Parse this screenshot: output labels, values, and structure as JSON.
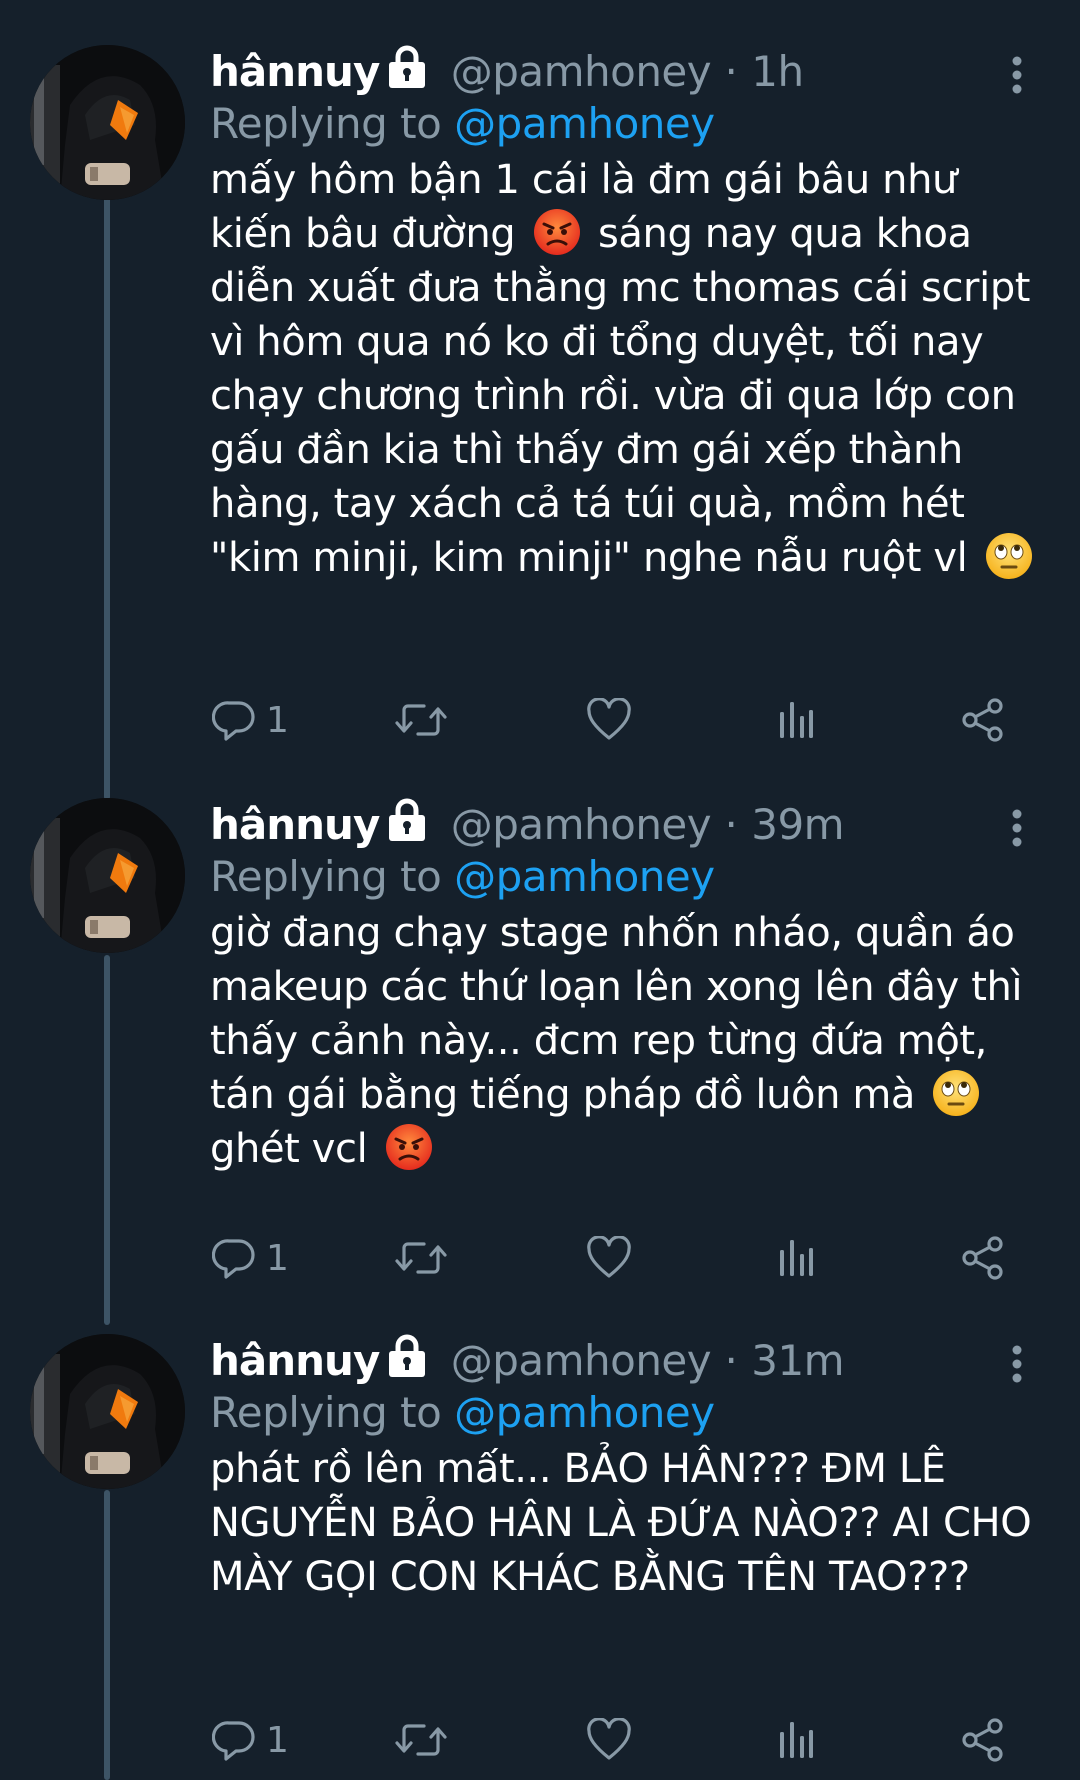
{
  "colors": {
    "background": "#15202b",
    "secondary_text": "#8899a6",
    "mention": "#1da1f2",
    "thread_line": "#3d5466"
  },
  "tweets": [
    {
      "name": "hânnuy",
      "handle": "@pamhoney",
      "dot": "·",
      "time": "1h",
      "replying_prefix": "Replying to",
      "replying_to": "@pamhoney",
      "body_parts": [
        "mấy hôm bận 1 cái là đm gái bâu như kiến bâu đường",
        "sáng nay qua khoa diễn xuất đưa thằng mc thomas cái script vì hôm qua nó ko đi tổng duyệt, tối nay chạy chương trình rồi. vừa đi qua lớp con gấu đần kia thì thấy đm gái xếp thành hàng, tay xách cả tá túi quà, mồm hét \"kim minji, kim minji\" nghe nẫu ruột vl"
      ],
      "emojis": [
        "angry-face",
        "face-with-rolling-eyes"
      ],
      "reply_count": "1"
    },
    {
      "name": "hânnuy",
      "handle": "@pamhoney",
      "dot": "·",
      "time": "39m",
      "replying_prefix": "Replying to",
      "replying_to": "@pamhoney",
      "body_parts": [
        "giờ đang chạy stage nhốn nháo, quần áo makeup các thứ loạn lên xong lên đây thì thấy cảnh này... đcm rep từng đứa một, tán gái bằng tiếng pháp đồ luôn mà",
        "ghét vcl"
      ],
      "emojis": [
        "face-with-rolling-eyes",
        "angry-face"
      ],
      "reply_count": "1"
    },
    {
      "name": "hânnuy",
      "handle": "@pamhoney",
      "dot": "·",
      "time": "31m",
      "replying_prefix": "Replying to",
      "replying_to": "@pamhoney",
      "body_parts": [
        "phát rồ lên mất... BẢO HÂN??? ĐM LÊ NGUYỄN BẢO HÂN LÀ ĐỨA NÀO?? AI CHO MÀY GỌI CON KHÁC BẰNG TÊN TAO???"
      ],
      "emojis": [],
      "reply_count": "1"
    }
  ],
  "icons": {
    "lock": "lock-icon",
    "more": "more-vertical-icon",
    "reply": "reply-icon",
    "retweet": "retweet-icon",
    "like": "heart-icon",
    "analytics": "analytics-icon",
    "share": "share-icon"
  }
}
